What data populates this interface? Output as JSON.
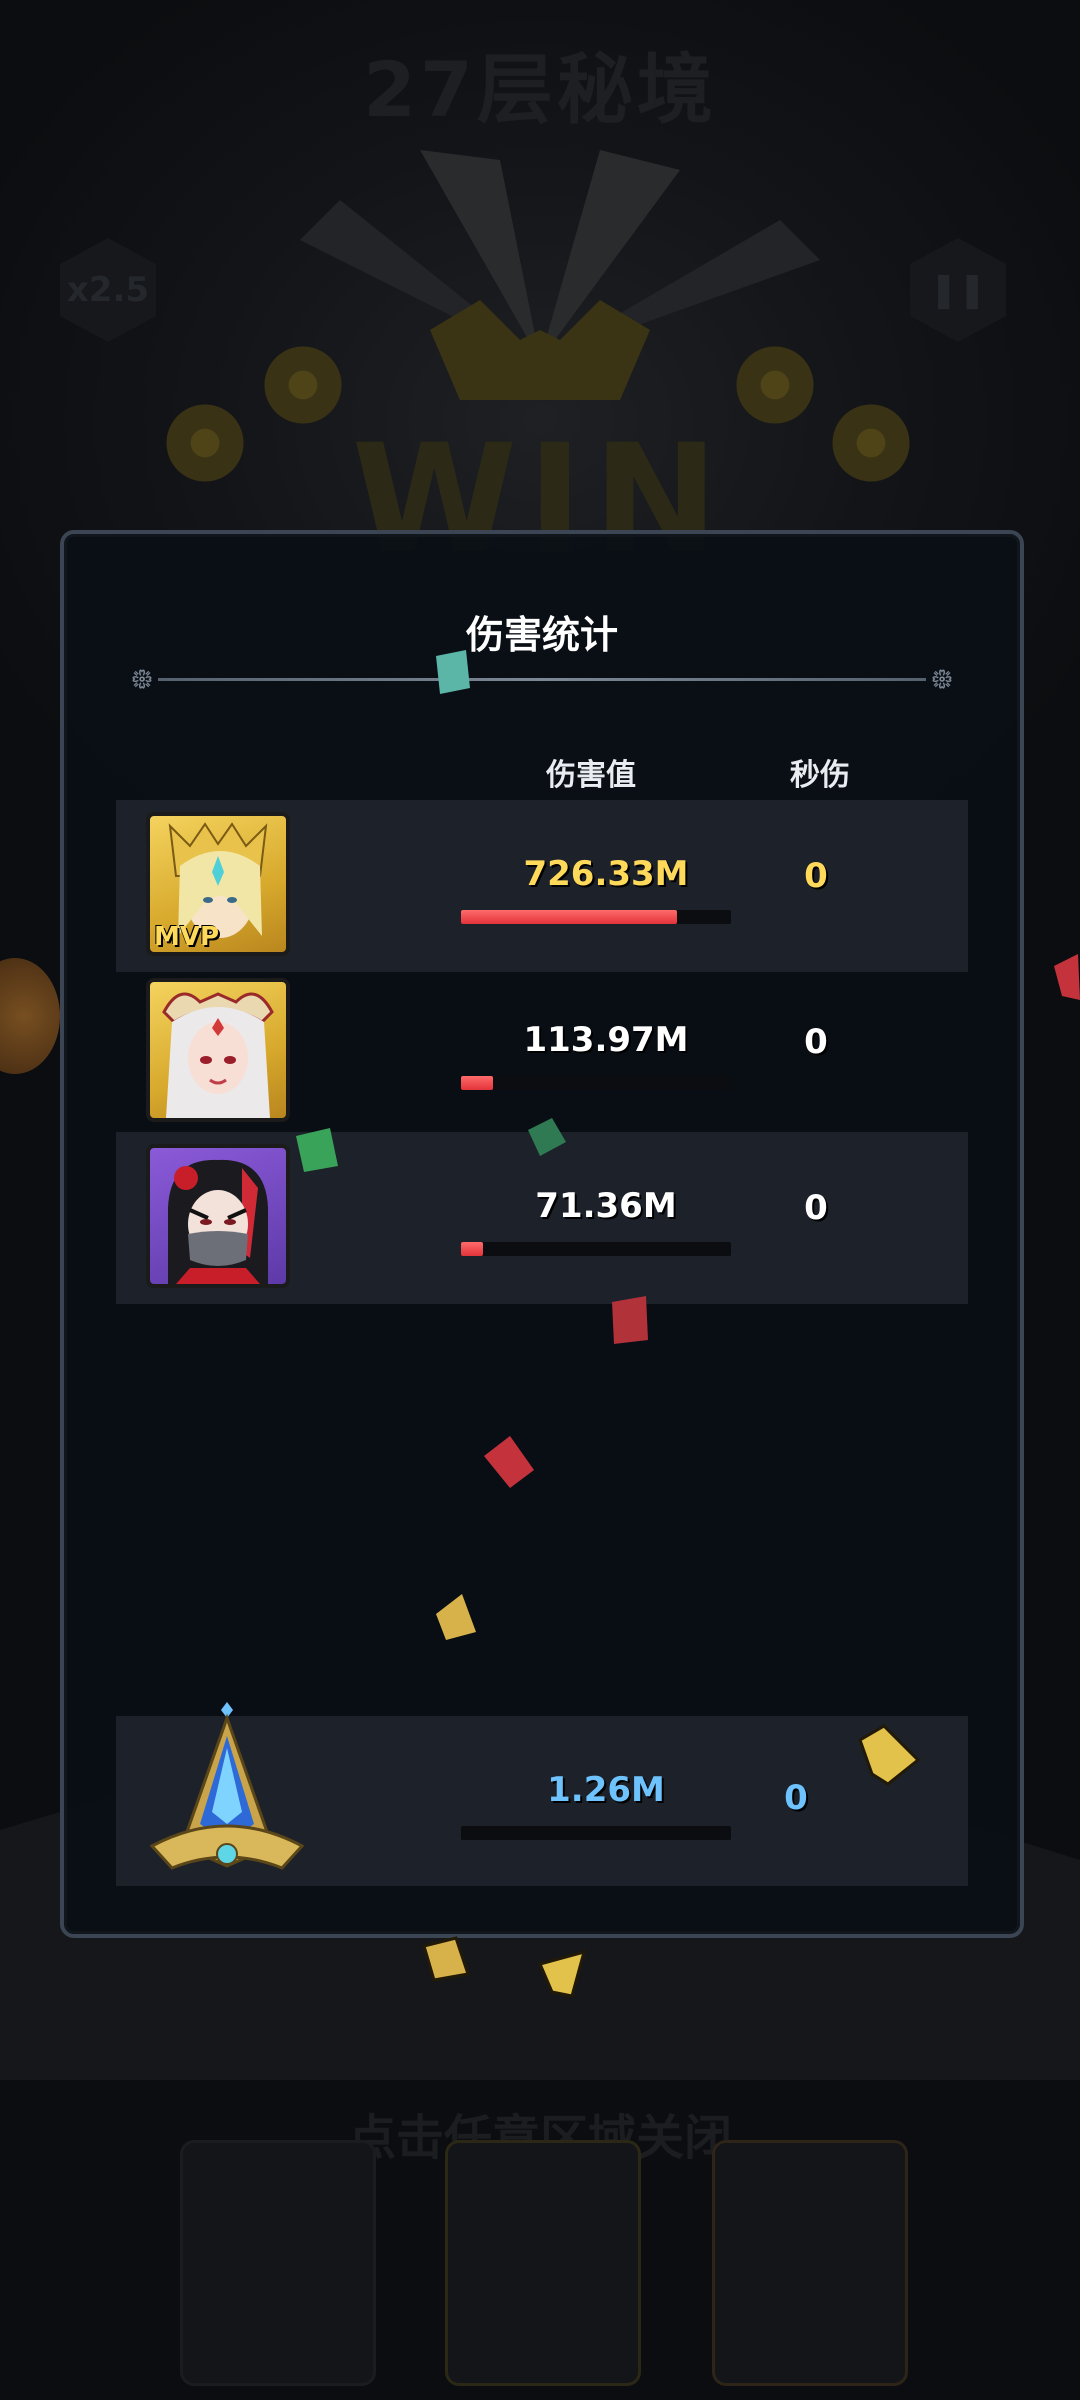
{
  "background": {
    "title": "27层秘境",
    "speed_badge": "x2.5",
    "close_hint": "点击任意区域关闭"
  },
  "panel": {
    "title": "伤害统计",
    "columns": {
      "damage": "伤害值",
      "dps": "秒伤"
    },
    "mvp_label": "MVP",
    "rows": [
      {
        "hero_icon": "golden-elf-hero-portrait",
        "damage": "726.33M",
        "damage_fraction": 0.8,
        "dps": "0",
        "value_color": "#ffd95a",
        "dps_color": "#ffd95a"
      },
      {
        "hero_icon": "white-haired-priestess-portrait",
        "damage": "113.97M",
        "damage_fraction": 0.12,
        "dps": "0",
        "value_color": "#ffffff",
        "dps_color": "#ffffff"
      },
      {
        "hero_icon": "masked-ninja-portrait",
        "damage": "71.36M",
        "damage_fraction": 0.08,
        "dps": "0",
        "value_color": "#ffffff",
        "dps_color": "#ffffff"
      }
    ],
    "artifact_row": {
      "icon": "crystal-artifact-icon",
      "damage": "1.26M",
      "damage_fraction": 0,
      "dps": "0",
      "value_color": "#6ec3ff"
    }
  }
}
